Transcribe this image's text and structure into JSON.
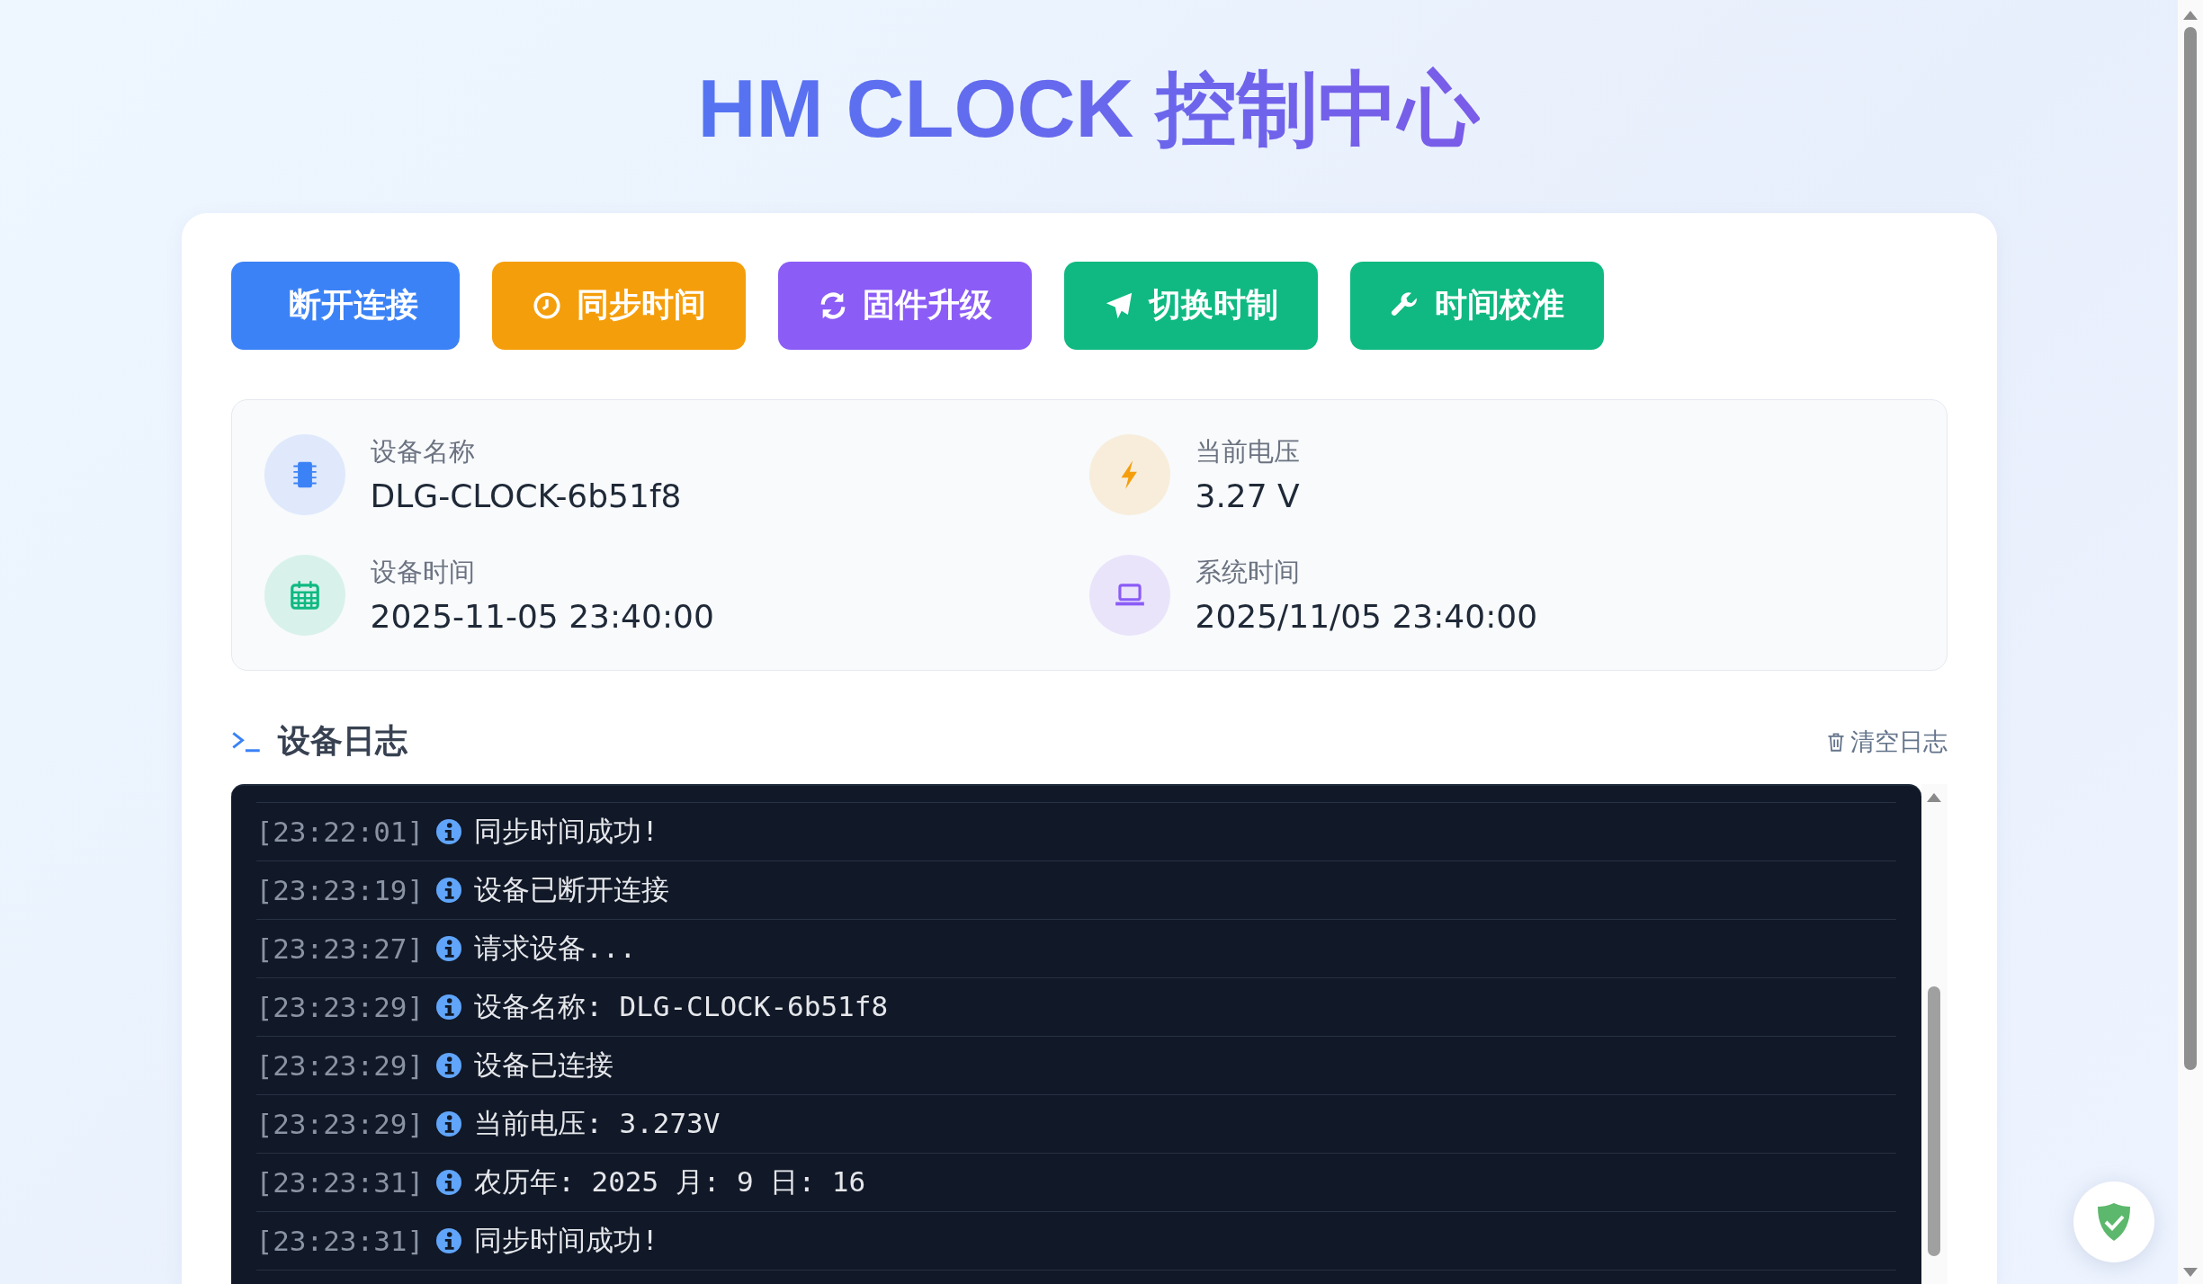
{
  "title": "HM CLOCK 控制中心",
  "buttons": [
    {
      "label": "断开连接",
      "kind": "plain",
      "color": "#3b82f6"
    },
    {
      "label": "同步时间",
      "kind": "clock",
      "color": "#f59e0b"
    },
    {
      "label": "固件升级",
      "kind": "refresh",
      "color": "#8b5cf6"
    },
    {
      "label": "切换时制",
      "kind": "send",
      "color": "#10b981"
    },
    {
      "label": "时间校准",
      "kind": "wrench",
      "color": "#10b981"
    }
  ],
  "device_info": [
    {
      "label": "设备名称",
      "value": "DLG-CLOCK-6b51f8",
      "kind": "chip",
      "color": "#3b82f6"
    },
    {
      "label": "当前电压",
      "value": "3.27 V",
      "kind": "bolt",
      "color": "#f59e0b"
    },
    {
      "label": "设备时间",
      "value": "2025-11-05 23:40:00",
      "kind": "calendar",
      "color": "#10b981"
    },
    {
      "label": "系统时间",
      "value": "2025/11/05 23:40:00",
      "kind": "laptop",
      "color": "#8b5cf6"
    }
  ],
  "log": {
    "title": "设备日志",
    "clear_label": "清空日志",
    "entries": [
      {
        "time": "[23:22:01]",
        "kind": "info",
        "message": "同步时间成功!"
      },
      {
        "time": "[23:23:19]",
        "kind": "info",
        "message": "设备已断开连接"
      },
      {
        "time": "[23:23:27]",
        "kind": "info",
        "message": "请求设备..."
      },
      {
        "time": "[23:23:29]",
        "kind": "info",
        "message": "设备名称: DLG-CLOCK-6b51f8"
      },
      {
        "time": "[23:23:29]",
        "kind": "info",
        "message": "设备已连接"
      },
      {
        "time": "[23:23:29]",
        "kind": "info",
        "message": "当前电压: 3.273V"
      },
      {
        "time": "[23:23:31]",
        "kind": "info",
        "message": "农历年: 2025 月: 9 日: 16"
      },
      {
        "time": "[23:23:31]",
        "kind": "info",
        "message": "同步时间成功!"
      }
    ]
  }
}
